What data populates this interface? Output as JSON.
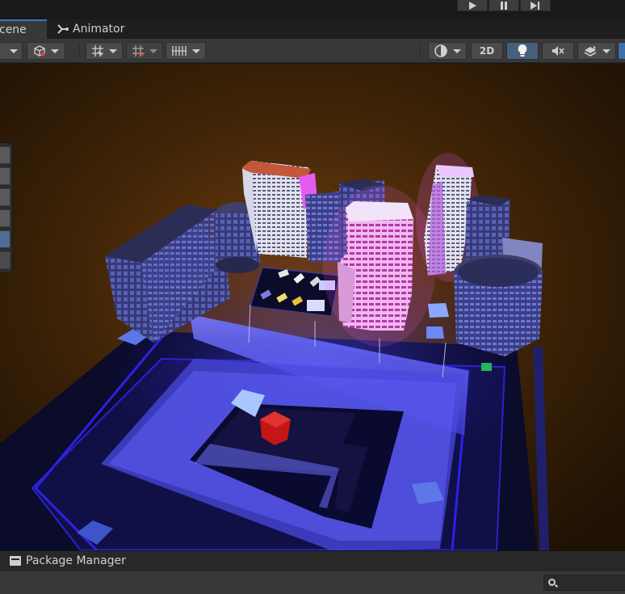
{
  "tabs": {
    "scene": "cene",
    "animator": "Animator"
  },
  "toolbar": {
    "mode_2d": "2D"
  },
  "bottom": {
    "package_manager": "Package Manager",
    "search_placeholder": ""
  },
  "colors": {
    "accent": "#3a79bb",
    "toggle_on": "#46607c",
    "scene_glow": "#3a2cff",
    "building_glow": "#ff5cff"
  },
  "icons": [
    "play-icon",
    "pause-icon",
    "step-icon",
    "shaded-mode-icon",
    "gizmo-cube-icon",
    "grid-snap-icon",
    "increment-snap-icon",
    "grid-toggle-icon",
    "draw-mode-icon",
    "lighting-icon",
    "audio-mute-icon",
    "effects-icon",
    "search-icon",
    "package-icon"
  ]
}
